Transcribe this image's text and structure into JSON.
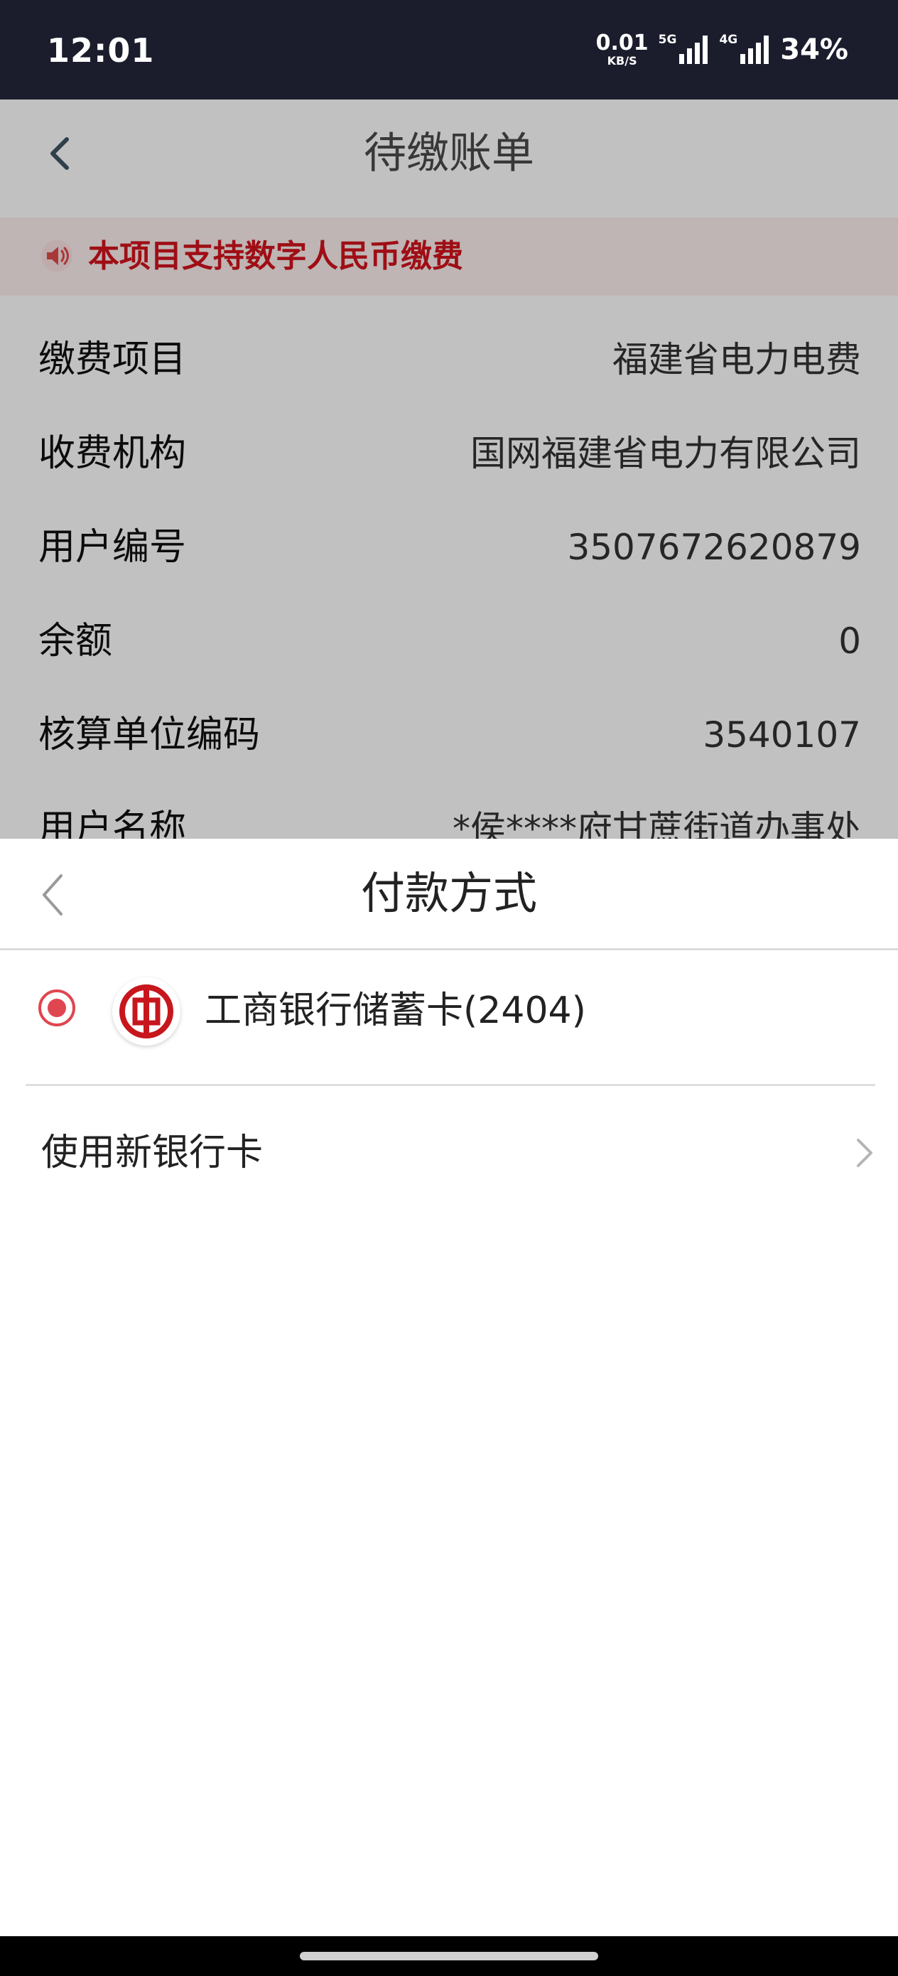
{
  "status_bar": {
    "time": "12:01",
    "net_speed_value": "0.01",
    "net_speed_unit": "KB/S",
    "signal1_label": "5G",
    "signal2_label": "4G",
    "battery": "34%"
  },
  "page": {
    "title": "待缴账单",
    "notice": "本项目支持数字人民币缴费",
    "rows": [
      {
        "label": "缴费项目",
        "value": "福建省电力电费"
      },
      {
        "label": "收费机构",
        "value": "国网福建省电力有限公司"
      },
      {
        "label": "用户编号",
        "value": "3507672620879"
      },
      {
        "label": "余额",
        "value": "0"
      },
      {
        "label": "核算单位编码",
        "value": "3540107"
      },
      {
        "label": "用户名称",
        "value": "*侯****府甘蔗街道办事处"
      }
    ]
  },
  "payment_sheet": {
    "title": "付款方式",
    "options": [
      {
        "label": "工商银行储蓄卡(2404)",
        "selected": true,
        "icon": "icbc-logo-icon"
      }
    ],
    "new_card_label": "使用新银行卡"
  },
  "colors": {
    "status_bar_bg": "#1b1d2d",
    "notice_text": "#d2131c",
    "accent_red": "#e0464f",
    "bank_red": "#c8161d"
  }
}
